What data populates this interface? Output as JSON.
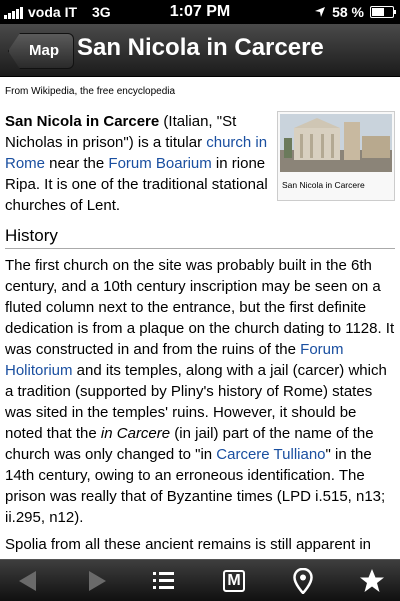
{
  "status": {
    "carrier": "voda IT",
    "network": "3G",
    "time": "1:07 PM",
    "battery": "58 %",
    "battery_level": 0.58
  },
  "nav": {
    "back_label": "Map",
    "title": "San Nicola in Carcere"
  },
  "article": {
    "source": "From Wikipedia, the free encyclopedia",
    "image_caption": "San Nicola in Carcere",
    "intro": {
      "bold_title": "San Nicola in Carcere",
      "t1": " (Italian, \"St Nicholas in prison\") is a titular ",
      "link1": "church in Rome",
      "t2": " near the ",
      "link2": "Forum Boarium",
      "t3": " in rione Ripa. It is one of the traditional stational churches of Lent."
    },
    "history_heading": "History",
    "history_p1": {
      "t1": "The first church on the site was probably built in the 6th century, and a 10th century inscription may be seen on a fluted column next to the entrance, but the first definite dedication is from a plaque on the church dating to 1128. It was constructed in and from the ruins of the ",
      "link1": "Forum Holitorium",
      "t2": " and its temples, along with a jail (carcer) which a tradition (supported by Pliny's history of Rome) states was sited in the temples' ruins. However, it should be noted that the ",
      "italic": "in Carcere",
      "t3": " (in jail) part of the name of the church was only changed to \"in ",
      "link2": "Carcere Tulliano",
      "t4": "\" in the 14th century, owing to an erroneous identification. The prison was really that of Byzantine times (LPD i.515, n13; ii.295, n12)."
    },
    "history_p2": "Spolia from all these ancient remains is still apparent in the church's construction, most particularly three columns from the"
  },
  "toolbar": {
    "items": [
      "back-arrow-icon",
      "forward-arrow-icon",
      "list-icon",
      "metro-icon",
      "location-pin-icon",
      "star-icon"
    ],
    "metro_letter": "M"
  }
}
